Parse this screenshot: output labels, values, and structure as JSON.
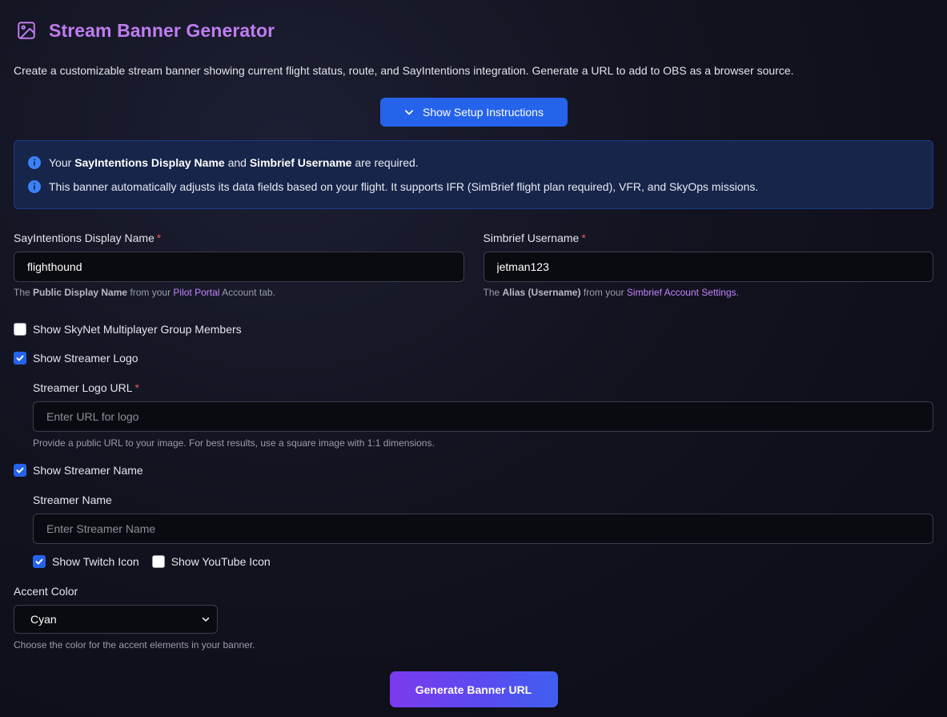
{
  "header": {
    "icon": "image-icon",
    "title": "Stream Banner Generator"
  },
  "description": "Create a customizable stream banner showing current flight status, route, and SayIntentions integration. Generate a URL to add to OBS as a browser source.",
  "setup_button": {
    "label": "Show Setup Instructions",
    "icon": "chevron-down-icon"
  },
  "info": {
    "line1": {
      "pre": "Your ",
      "bold1": "SayIntentions Display Name",
      "mid": " and ",
      "bold2": "Simbrief Username",
      "post": " are required."
    },
    "line2": "This banner automatically adjusts its data fields based on your flight. It supports IFR (SimBrief flight plan required), VFR, and SkyOps missions.",
    "accent": "#3b82f6"
  },
  "display_name": {
    "label": "SayIntentions Display Name",
    "required": "*",
    "value": "flighthound",
    "help": {
      "pre": "The ",
      "bold": "Public Display Name",
      "mid": " from your ",
      "link": "Pilot Portal",
      "post": " Account tab."
    }
  },
  "simbrief": {
    "label": "Simbrief Username",
    "required": "*",
    "value": "jetman123",
    "help": {
      "pre": "The ",
      "bold": "Alias (Username)",
      "mid": " from your ",
      "link": "Simbrief Account Settings",
      "post": "."
    }
  },
  "skynet": {
    "label": "Show SkyNet Multiplayer Group Members",
    "checked": false
  },
  "streamer_logo": {
    "label": "Show Streamer Logo",
    "checked": true,
    "url_label": "Streamer Logo URL",
    "required": "*",
    "placeholder": "Enter URL for logo",
    "help": "Provide a public URL to your image. For best results, use a square image with 1:1 dimensions."
  },
  "streamer_name": {
    "label": "Show Streamer Name",
    "checked": true,
    "name_label": "Streamer Name",
    "placeholder": "Enter Streamer Name",
    "twitch": {
      "label": "Show Twitch Icon",
      "checked": true
    },
    "youtube": {
      "label": "Show YouTube Icon",
      "checked": false
    }
  },
  "accent_color": {
    "label": "Accent Color",
    "selected": "Cyan",
    "help": "Choose the color for the accent elements in your banner."
  },
  "generate_button": {
    "label": "Generate Banner URL"
  },
  "colors": {
    "title": "#c07cf0",
    "primary": "#2563eb",
    "link": "#c084fc",
    "required": "#f05252"
  }
}
